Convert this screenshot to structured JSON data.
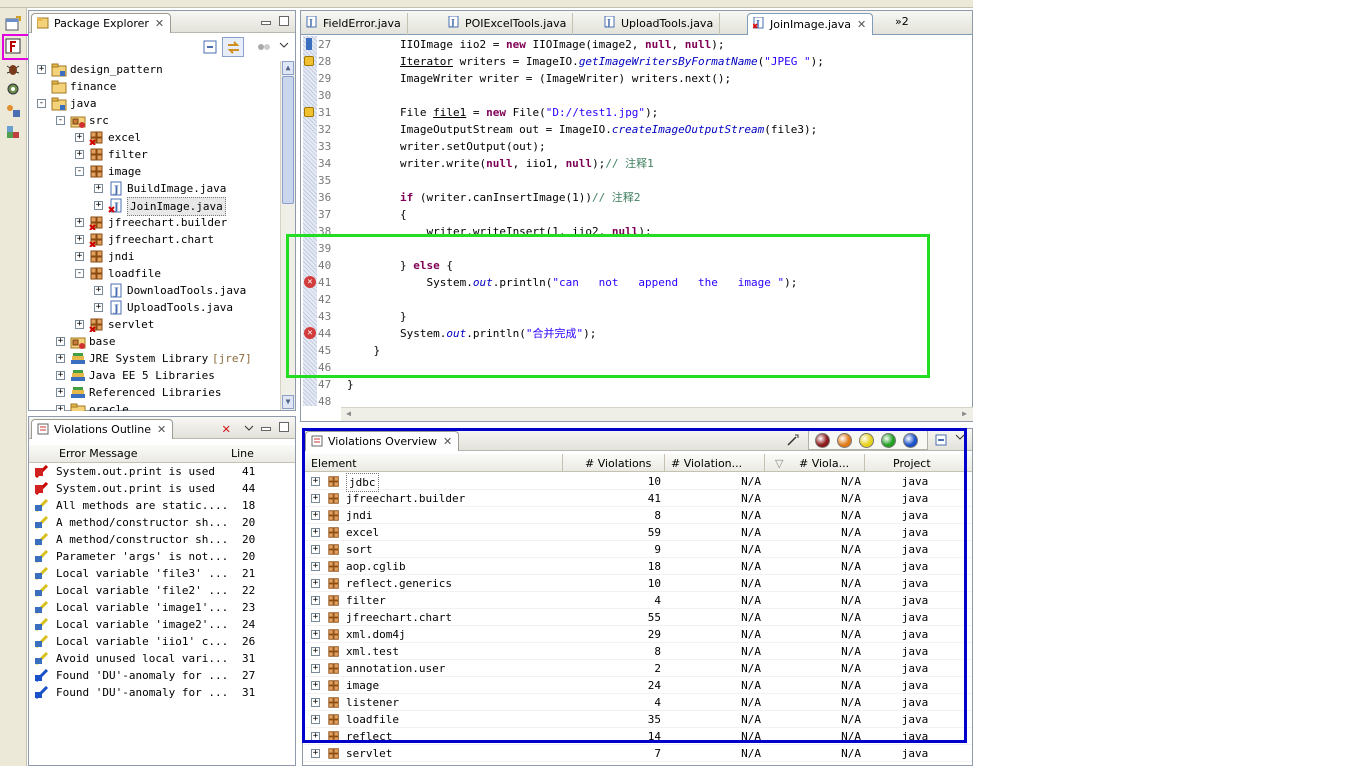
{
  "package_explorer": {
    "title": "Package Explorer",
    "tree": [
      {
        "label": "design_pattern",
        "icon": "project-folder-icon",
        "depth": 0,
        "expander": "+"
      },
      {
        "label": "finance",
        "icon": "folder-icon",
        "depth": 0,
        "expander": ""
      },
      {
        "label": "java",
        "icon": "project-folder-icon",
        "depth": 0,
        "expander": "-"
      },
      {
        "label": "src",
        "icon": "source-folder-icon",
        "depth": 1,
        "expander": "-"
      },
      {
        "label": "excel",
        "icon": "package-error-icon",
        "depth": 2,
        "expander": "+"
      },
      {
        "label": "filter",
        "icon": "package-icon",
        "depth": 2,
        "expander": "+"
      },
      {
        "label": "image",
        "icon": "package-icon",
        "depth": 2,
        "expander": "-"
      },
      {
        "label": "BuildImage.java",
        "icon": "java-file-icon",
        "depth": 3,
        "expander": "+"
      },
      {
        "label": "JoinImage.java",
        "icon": "java-file-error-icon",
        "depth": 3,
        "expander": "+",
        "selected": true
      },
      {
        "label": "jfreechart.builder",
        "icon": "package-error-icon",
        "depth": 2,
        "expander": "+"
      },
      {
        "label": "jfreechart.chart",
        "icon": "package-error-icon",
        "depth": 2,
        "expander": "+"
      },
      {
        "label": "jndi",
        "icon": "package-icon",
        "depth": 2,
        "expander": "+"
      },
      {
        "label": "loadfile",
        "icon": "package-icon",
        "depth": 2,
        "expander": "-"
      },
      {
        "label": "DownloadTools.java",
        "icon": "java-file-icon",
        "depth": 3,
        "expander": "+"
      },
      {
        "label": "UploadTools.java",
        "icon": "java-file-icon",
        "depth": 3,
        "expander": "+"
      },
      {
        "label": "servlet",
        "icon": "package-error-icon",
        "depth": 2,
        "expander": "+"
      },
      {
        "label": "base",
        "icon": "source-folder-icon",
        "depth": 1,
        "expander": "+"
      },
      {
        "label": "JRE System Library",
        "suffix": "[jre7]",
        "icon": "library-icon",
        "depth": 1,
        "expander": "+"
      },
      {
        "label": "Java EE 5 Libraries",
        "icon": "library-icon",
        "depth": 1,
        "expander": "+"
      },
      {
        "label": "Referenced Libraries",
        "icon": "library-icon",
        "depth": 1,
        "expander": "+"
      },
      {
        "label": "oracle",
        "icon": "folder-icon",
        "depth": 1,
        "expander": "+"
      }
    ]
  },
  "editor": {
    "tabs": [
      {
        "label": "FieldError.java",
        "active": false
      },
      {
        "label": "POIExcelTools.java",
        "active": false
      },
      {
        "label": "UploadTools.java",
        "active": false
      },
      {
        "label": "JoinImage.java",
        "active": true
      }
    ],
    "overflow_label": "»2",
    "lines": [
      {
        "no": "27",
        "html": "        IIOImage iio2 = <span class=\"kw\">new</span> IIOImage(image2, <span class=\"kw\">null</span>, <span class=\"kw\">null</span>);"
      },
      {
        "no": "28",
        "html": "        <u>Iterator</u> writers = ImageIO.<span class=\"ital\">getImageWritersByFormatName</span>(<span class=\"str\">\"JPEG \"</span>);"
      },
      {
        "no": "29",
        "html": "        ImageWriter writer = (ImageWriter) writers.next();"
      },
      {
        "no": "30",
        "html": ""
      },
      {
        "no": "31",
        "html": "        File <u>file1</u> = <span class=\"kw\">new</span> File(<span class=\"str\">\"D://test1.jpg\"</span>);"
      },
      {
        "no": "32",
        "html": "        ImageOutputStream out = ImageIO.<span class=\"ital\">createImageOutputStream</span>(file3);"
      },
      {
        "no": "33",
        "html": "        writer.setOutput(out);"
      },
      {
        "no": "34",
        "html": "        writer.write(<span class=\"kw\">null</span>, iio1, <span class=\"kw\">null</span>);<span class=\"cmt\">// 注释1</span>"
      },
      {
        "no": "35",
        "html": ""
      },
      {
        "no": "36",
        "html": "        <span class=\"kw\">if</span> (writer.canInsertImage(1))<span class=\"cmt\">// 注释2</span>"
      },
      {
        "no": "37",
        "html": "        {"
      },
      {
        "no": "38",
        "html": "            writer.writeInsert(1, iio2, <span class=\"kw\">null</span>);"
      },
      {
        "no": "39",
        "html": ""
      },
      {
        "no": "40",
        "html": "        } <span class=\"kw\">else</span> {"
      },
      {
        "no": "41",
        "html": "            System.<span class=\"ital\">out</span>.println(<span class=\"str\">\"can   not   append   the   image \"</span>);"
      },
      {
        "no": "42",
        "html": ""
      },
      {
        "no": "43",
        "html": "        }"
      },
      {
        "no": "44",
        "html": "        System.<span class=\"ital\">out</span>.println(<span class=\"str\">\"合并完成\"</span>);"
      },
      {
        "no": "45",
        "html": "    }"
      },
      {
        "no": "46",
        "html": ""
      },
      {
        "no": "47",
        "html": "}"
      },
      {
        "no": "48",
        "html": ""
      }
    ]
  },
  "violations_outline": {
    "title": "Violations Outline",
    "columns": [
      "Error Message",
      "Line"
    ],
    "rows": [
      {
        "msg": "System.out.print is used",
        "line": "41",
        "priority": "high"
      },
      {
        "msg": "System.out.print is used",
        "line": "44",
        "priority": "high"
      },
      {
        "msg": "All methods are static....",
        "line": "18",
        "priority": "medium"
      },
      {
        "msg": "A method/constructor sh...",
        "line": "20",
        "priority": "medium"
      },
      {
        "msg": "A method/constructor sh...",
        "line": "20",
        "priority": "medium"
      },
      {
        "msg": "Parameter 'args' is not...",
        "line": "20",
        "priority": "medium"
      },
      {
        "msg": "Local variable 'file3' ...",
        "line": "21",
        "priority": "medium"
      },
      {
        "msg": "Local variable 'file2' ...",
        "line": "22",
        "priority": "medium"
      },
      {
        "msg": "Local variable 'image1'...",
        "line": "23",
        "priority": "medium"
      },
      {
        "msg": "Local variable 'image2'...",
        "line": "24",
        "priority": "medium"
      },
      {
        "msg": "Local variable 'iio1' c...",
        "line": "26",
        "priority": "medium"
      },
      {
        "msg": "Avoid unused local vari...",
        "line": "31",
        "priority": "medium"
      },
      {
        "msg": "Found 'DU'-anomaly for ...",
        "line": "27",
        "priority": "low"
      },
      {
        "msg": "Found 'DU'-anomaly for ...",
        "line": "31",
        "priority": "low"
      }
    ]
  },
  "violations_overview": {
    "title": "Violations Overview",
    "columns": [
      "Element",
      "# Violations",
      "# Violation...",
      "# Viola...",
      "Project"
    ],
    "rows": [
      {
        "name": "jdbc",
        "v": "10",
        "c2": "N/A",
        "c3": "N/A",
        "project": "java"
      },
      {
        "name": "jfreechart.builder",
        "v": "41",
        "c2": "N/A",
        "c3": "N/A",
        "project": "java"
      },
      {
        "name": "jndi",
        "v": "8",
        "c2": "N/A",
        "c3": "N/A",
        "project": "java"
      },
      {
        "name": "excel",
        "v": "59",
        "c2": "N/A",
        "c3": "N/A",
        "project": "java"
      },
      {
        "name": "sort",
        "v": "9",
        "c2": "N/A",
        "c3": "N/A",
        "project": "java"
      },
      {
        "name": "aop.cglib",
        "v": "18",
        "c2": "N/A",
        "c3": "N/A",
        "project": "java"
      },
      {
        "name": "reflect.generics",
        "v": "10",
        "c2": "N/A",
        "c3": "N/A",
        "project": "java"
      },
      {
        "name": "filter",
        "v": "4",
        "c2": "N/A",
        "c3": "N/A",
        "project": "java"
      },
      {
        "name": "jfreechart.chart",
        "v": "55",
        "c2": "N/A",
        "c3": "N/A",
        "project": "java"
      },
      {
        "name": "xml.dom4j",
        "v": "29",
        "c2": "N/A",
        "c3": "N/A",
        "project": "java"
      },
      {
        "name": "xml.test",
        "v": "8",
        "c2": "N/A",
        "c3": "N/A",
        "project": "java"
      },
      {
        "name": "annotation.user",
        "v": "2",
        "c2": "N/A",
        "c3": "N/A",
        "project": "java"
      },
      {
        "name": "image",
        "v": "24",
        "c2": "N/A",
        "c3": "N/A",
        "project": "java"
      },
      {
        "name": "listener",
        "v": "4",
        "c2": "N/A",
        "c3": "N/A",
        "project": "java"
      },
      {
        "name": "loadfile",
        "v": "35",
        "c2": "N/A",
        "c3": "N/A",
        "project": "java"
      },
      {
        "name": "reflect",
        "v": "14",
        "c2": "N/A",
        "c3": "N/A",
        "project": "java"
      },
      {
        "name": "servlet",
        "v": "7",
        "c2": "N/A",
        "c3": "N/A",
        "project": "java"
      }
    ],
    "priority_colors": [
      "#8b1a1a",
      "#e07b1a",
      "#e6d21a",
      "#22a022",
      "#1a50c8"
    ]
  },
  "colors": {
    "highlight_green": "#22dd22",
    "highlight_blue": "#0000cc",
    "highlight_magenta": "#e000e0"
  }
}
